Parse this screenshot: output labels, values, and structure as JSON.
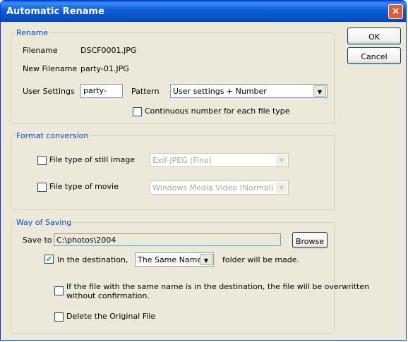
{
  "window": {
    "title": "Automatic Rename",
    "close_icon": "×"
  },
  "buttons": {
    "ok": "OK",
    "cancel": "Cancel",
    "browse": "Browse"
  },
  "rename": {
    "legend": "Rename",
    "filename_label": "Filename",
    "filename_value": "DSCF0001.JPG",
    "new_filename_label": "New Filename",
    "new_filename_value": "party-01.JPG",
    "user_settings_label": "User Settings",
    "user_settings_value": "party-",
    "pattern_label": "Pattern",
    "pattern_value": "User settings + Number",
    "continuous_label": "Continuous number for each file type",
    "continuous_checked": false
  },
  "format": {
    "legend": "Format conversion",
    "still_label": "File type of still image",
    "still_value": "Exif-JPEG (Fine)",
    "movie_label": "File type of movie",
    "movie_value": "Windows Media Video (Normal)"
  },
  "saving": {
    "legend": "Way of Saving",
    "save_to_label": "Save to",
    "save_to_value": "C:\\photos\\2004",
    "destination_label": "In the destination,",
    "destination_value": "The Same Name",
    "destination_suffix": "folder will be made.",
    "overwrite_label_line1": "If the file with the same name is in the destination, the file will be overwritten",
    "overwrite_label_line2": "without confirmation.",
    "delete_label": "Delete the Original File"
  },
  "icons": {
    "dropdown": "▼",
    "check": "✔"
  }
}
